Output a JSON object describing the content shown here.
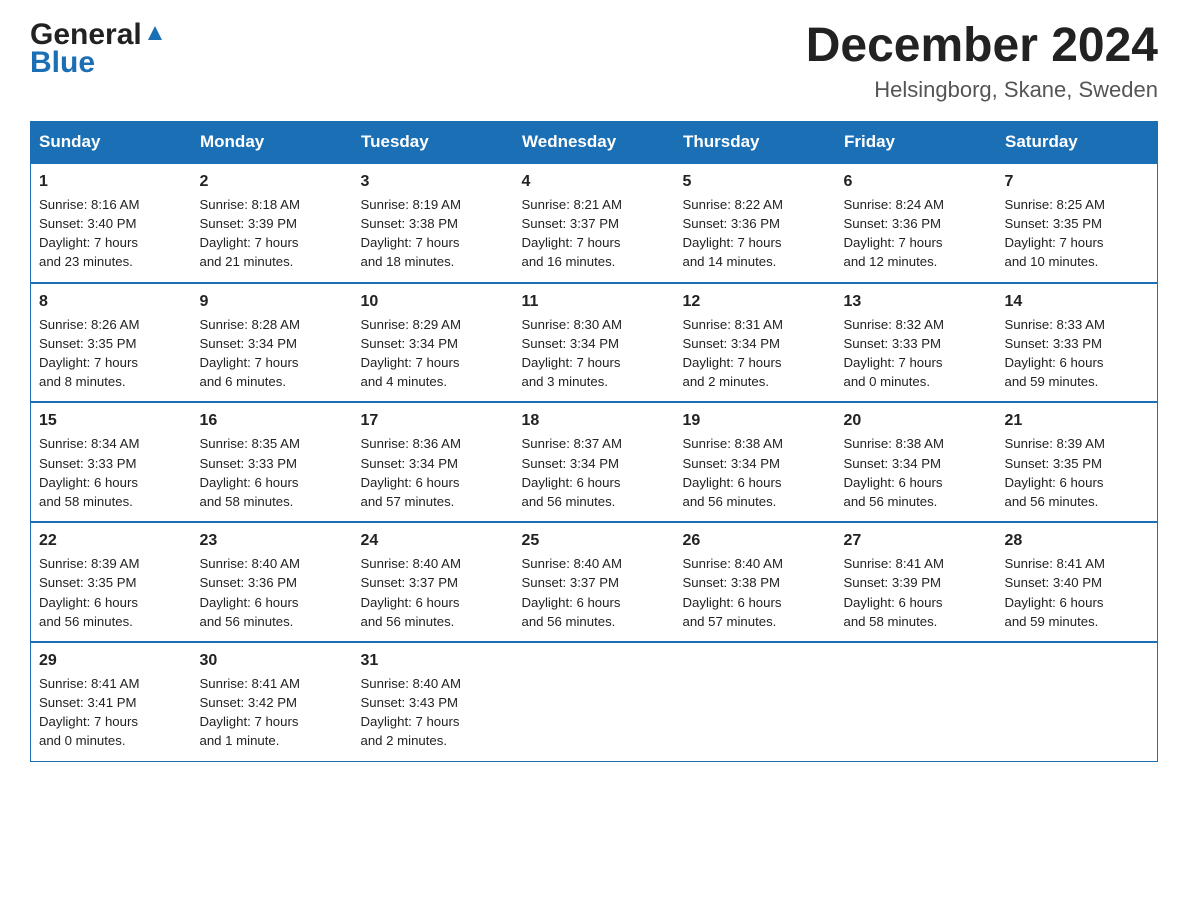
{
  "header": {
    "logo": {
      "general": "General",
      "blue": "Blue",
      "triangle_color": "#1a6fb5"
    },
    "title": "December 2024",
    "location": "Helsingborg, Skane, Sweden"
  },
  "calendar": {
    "days_of_week": [
      "Sunday",
      "Monday",
      "Tuesday",
      "Wednesday",
      "Thursday",
      "Friday",
      "Saturday"
    ],
    "weeks": [
      [
        {
          "day": "1",
          "info": "Sunrise: 8:16 AM\nSunset: 3:40 PM\nDaylight: 7 hours\nand 23 minutes."
        },
        {
          "day": "2",
          "info": "Sunrise: 8:18 AM\nSunset: 3:39 PM\nDaylight: 7 hours\nand 21 minutes."
        },
        {
          "day": "3",
          "info": "Sunrise: 8:19 AM\nSunset: 3:38 PM\nDaylight: 7 hours\nand 18 minutes."
        },
        {
          "day": "4",
          "info": "Sunrise: 8:21 AM\nSunset: 3:37 PM\nDaylight: 7 hours\nand 16 minutes."
        },
        {
          "day": "5",
          "info": "Sunrise: 8:22 AM\nSunset: 3:36 PM\nDaylight: 7 hours\nand 14 minutes."
        },
        {
          "day": "6",
          "info": "Sunrise: 8:24 AM\nSunset: 3:36 PM\nDaylight: 7 hours\nand 12 minutes."
        },
        {
          "day": "7",
          "info": "Sunrise: 8:25 AM\nSunset: 3:35 PM\nDaylight: 7 hours\nand 10 minutes."
        }
      ],
      [
        {
          "day": "8",
          "info": "Sunrise: 8:26 AM\nSunset: 3:35 PM\nDaylight: 7 hours\nand 8 minutes."
        },
        {
          "day": "9",
          "info": "Sunrise: 8:28 AM\nSunset: 3:34 PM\nDaylight: 7 hours\nand 6 minutes."
        },
        {
          "day": "10",
          "info": "Sunrise: 8:29 AM\nSunset: 3:34 PM\nDaylight: 7 hours\nand 4 minutes."
        },
        {
          "day": "11",
          "info": "Sunrise: 8:30 AM\nSunset: 3:34 PM\nDaylight: 7 hours\nand 3 minutes."
        },
        {
          "day": "12",
          "info": "Sunrise: 8:31 AM\nSunset: 3:34 PM\nDaylight: 7 hours\nand 2 minutes."
        },
        {
          "day": "13",
          "info": "Sunrise: 8:32 AM\nSunset: 3:33 PM\nDaylight: 7 hours\nand 0 minutes."
        },
        {
          "day": "14",
          "info": "Sunrise: 8:33 AM\nSunset: 3:33 PM\nDaylight: 6 hours\nand 59 minutes."
        }
      ],
      [
        {
          "day": "15",
          "info": "Sunrise: 8:34 AM\nSunset: 3:33 PM\nDaylight: 6 hours\nand 58 minutes."
        },
        {
          "day": "16",
          "info": "Sunrise: 8:35 AM\nSunset: 3:33 PM\nDaylight: 6 hours\nand 58 minutes."
        },
        {
          "day": "17",
          "info": "Sunrise: 8:36 AM\nSunset: 3:34 PM\nDaylight: 6 hours\nand 57 minutes."
        },
        {
          "day": "18",
          "info": "Sunrise: 8:37 AM\nSunset: 3:34 PM\nDaylight: 6 hours\nand 56 minutes."
        },
        {
          "day": "19",
          "info": "Sunrise: 8:38 AM\nSunset: 3:34 PM\nDaylight: 6 hours\nand 56 minutes."
        },
        {
          "day": "20",
          "info": "Sunrise: 8:38 AM\nSunset: 3:34 PM\nDaylight: 6 hours\nand 56 minutes."
        },
        {
          "day": "21",
          "info": "Sunrise: 8:39 AM\nSunset: 3:35 PM\nDaylight: 6 hours\nand 56 minutes."
        }
      ],
      [
        {
          "day": "22",
          "info": "Sunrise: 8:39 AM\nSunset: 3:35 PM\nDaylight: 6 hours\nand 56 minutes."
        },
        {
          "day": "23",
          "info": "Sunrise: 8:40 AM\nSunset: 3:36 PM\nDaylight: 6 hours\nand 56 minutes."
        },
        {
          "day": "24",
          "info": "Sunrise: 8:40 AM\nSunset: 3:37 PM\nDaylight: 6 hours\nand 56 minutes."
        },
        {
          "day": "25",
          "info": "Sunrise: 8:40 AM\nSunset: 3:37 PM\nDaylight: 6 hours\nand 56 minutes."
        },
        {
          "day": "26",
          "info": "Sunrise: 8:40 AM\nSunset: 3:38 PM\nDaylight: 6 hours\nand 57 minutes."
        },
        {
          "day": "27",
          "info": "Sunrise: 8:41 AM\nSunset: 3:39 PM\nDaylight: 6 hours\nand 58 minutes."
        },
        {
          "day": "28",
          "info": "Sunrise: 8:41 AM\nSunset: 3:40 PM\nDaylight: 6 hours\nand 59 minutes."
        }
      ],
      [
        {
          "day": "29",
          "info": "Sunrise: 8:41 AM\nSunset: 3:41 PM\nDaylight: 7 hours\nand 0 minutes."
        },
        {
          "day": "30",
          "info": "Sunrise: 8:41 AM\nSunset: 3:42 PM\nDaylight: 7 hours\nand 1 minute."
        },
        {
          "day": "31",
          "info": "Sunrise: 8:40 AM\nSunset: 3:43 PM\nDaylight: 7 hours\nand 2 minutes."
        },
        {
          "day": "",
          "info": ""
        },
        {
          "day": "",
          "info": ""
        },
        {
          "day": "",
          "info": ""
        },
        {
          "day": "",
          "info": ""
        }
      ]
    ]
  }
}
